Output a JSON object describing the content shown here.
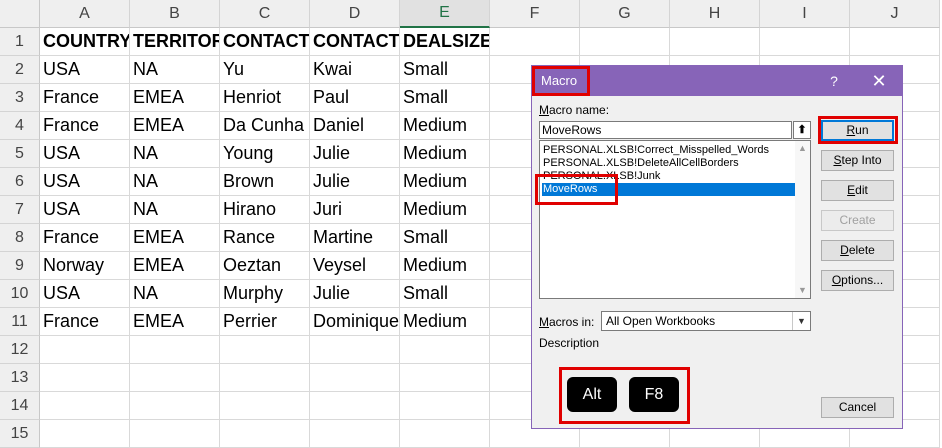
{
  "spreadsheet": {
    "columns": [
      "A",
      "B",
      "C",
      "D",
      "E",
      "F",
      "G",
      "H",
      "I",
      "J"
    ],
    "selected_column": "E",
    "rows": [
      "1",
      "2",
      "3",
      "4",
      "5",
      "6",
      "7",
      "8",
      "9",
      "10",
      "11",
      "12",
      "13",
      "14",
      "15"
    ],
    "cells": [
      [
        "COUNTRY",
        "TERRITOR",
        "CONTACT",
        "CONTACT",
        "DEALSIZE"
      ],
      [
        "USA",
        "NA",
        "Yu",
        "Kwai",
        "Small"
      ],
      [
        "France",
        "EMEA",
        "Henriot",
        "Paul",
        "Small"
      ],
      [
        "France",
        "EMEA",
        "Da Cunha",
        "Daniel",
        "Medium"
      ],
      [
        "USA",
        "NA",
        "Young",
        "Julie",
        "Medium"
      ],
      [
        "USA",
        "NA",
        "Brown",
        "Julie",
        "Medium"
      ],
      [
        "USA",
        "NA",
        "Hirano",
        "Juri",
        "Medium"
      ],
      [
        "France",
        "EMEA",
        "Rance",
        "Martine",
        "Small"
      ],
      [
        "Norway",
        "EMEA",
        "Oeztan",
        "Veysel",
        "Medium"
      ],
      [
        "USA",
        "NA",
        "Murphy",
        "Julie",
        "Small"
      ],
      [
        "France",
        "EMEA",
        "Perrier",
        "Dominique",
        "Medium"
      ]
    ]
  },
  "dialog": {
    "title": "Macro",
    "help": "?",
    "close": "✕",
    "macro_name_label_pre": "M",
    "macro_name_label_rest": "acro name:",
    "macro_name_value": "MoveRows",
    "up_icon": "⬆",
    "macros": [
      "PERSONAL.XLSB!Correct_Misspelled_Words",
      "PERSONAL.XLSB!DeleteAllCellBorders",
      "PERSONAL.XLSB!Junk",
      "MoveRows"
    ],
    "selected_macro": "MoveRows",
    "buttons": {
      "run_u": "R",
      "run_rest": "un",
      "step_u": "S",
      "step_rest": "tep Into",
      "edit_u": "E",
      "edit_rest": "dit",
      "create": "Create",
      "delete_u": "D",
      "delete_rest": "elete",
      "options_u": "O",
      "options_rest": "ptions...",
      "cancel": "Cancel"
    },
    "macros_in_label_pre": "M",
    "macros_in_label_rest": "acros in:",
    "macros_in_value": "All Open Workbooks",
    "description_label": "Description",
    "shortcut_keys": [
      "Alt",
      "F8"
    ]
  },
  "colors": {
    "titlebar": "#8764b8",
    "highlight": "#e00000",
    "selection": "#0078d7",
    "excel_green": "#217346"
  }
}
